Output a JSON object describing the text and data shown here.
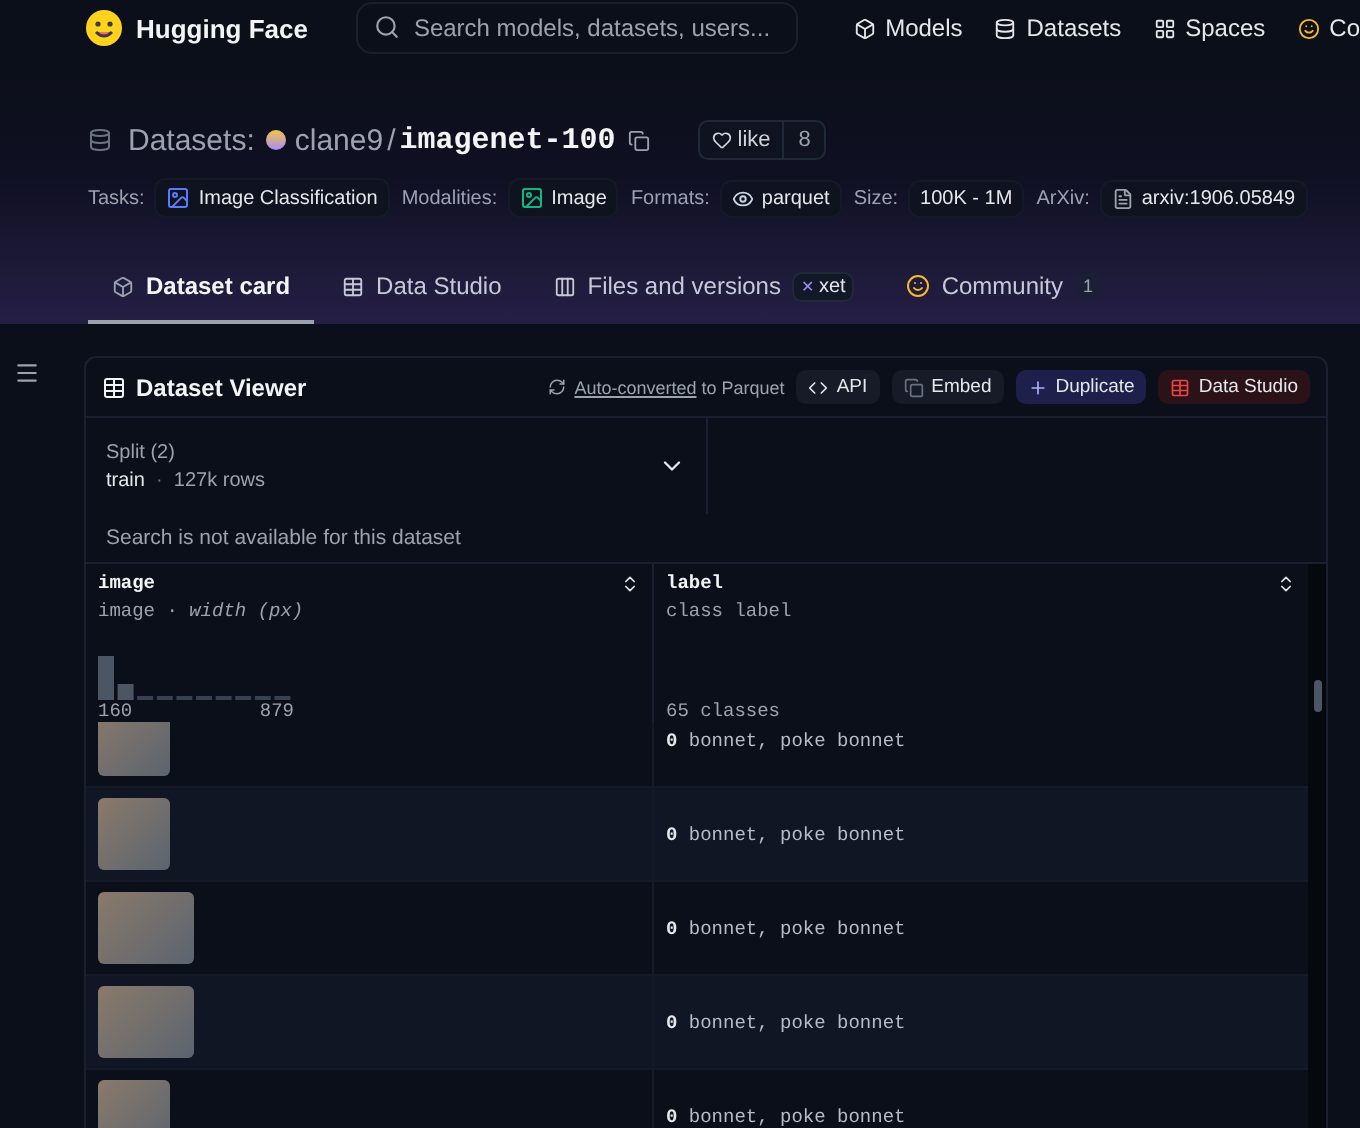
{
  "header": {
    "brand": "Hugging Face",
    "search": {
      "placeholder": "Search models, datasets, users..."
    },
    "nav": [
      {
        "label": "Models",
        "kind": "models"
      },
      {
        "label": "Datasets",
        "kind": "datasets"
      },
      {
        "label": "Spaces",
        "kind": "spaces"
      },
      {
        "label": "Co",
        "kind": "community"
      }
    ]
  },
  "repo": {
    "prefix": "Datasets:",
    "owner": "clane9",
    "separator": "/",
    "name": "imagenet-100",
    "like": {
      "label": "like",
      "count": "8"
    }
  },
  "tags": [
    {
      "key": "Tasks:",
      "value": "Image Classification",
      "kind": "task"
    },
    {
      "key": "Modalities:",
      "value": "Image",
      "kind": "modality"
    },
    {
      "key": "Formats:",
      "value": "parquet",
      "kind": "format"
    },
    {
      "key": "Size:",
      "value": "100K - 1M",
      "kind": "size"
    },
    {
      "key": "ArXiv:",
      "value": "arxiv:1906.05849",
      "kind": "arxiv"
    }
  ],
  "tabs": [
    {
      "label": "Dataset card",
      "selected": true,
      "kind": "card"
    },
    {
      "label": "Data Studio",
      "selected": false,
      "kind": "studio"
    },
    {
      "label": "Files and versions",
      "selected": false,
      "kind": "files",
      "badge": {
        "mark": "✕",
        "text": "xet"
      }
    },
    {
      "label": "Community",
      "selected": false,
      "kind": "community",
      "count": "1"
    }
  ],
  "viewer": {
    "title": "Dataset Viewer",
    "converted": {
      "link": "Auto-converted",
      "rest": "to Parquet"
    },
    "actions": [
      {
        "label": "API",
        "kind": "api"
      },
      {
        "label": "Embed",
        "kind": "embed"
      },
      {
        "label": "Duplicate",
        "kind": "duplicate"
      },
      {
        "label": "Data Studio",
        "kind": "studio"
      }
    ],
    "split": {
      "label": "Split (2)",
      "name": "train",
      "separator": "·",
      "rows": "127k rows"
    },
    "search_note": "Search is not available for this dataset",
    "columns": [
      {
        "name": "image",
        "subtitle": "image · *width (px)*",
        "min": "160",
        "max": "879"
      },
      {
        "name": "label",
        "subtitle": "class label",
        "summary": "65 classes"
      }
    ],
    "rows": [
      {
        "kind": "square",
        "label": "**0** bonnet, poke bonnet"
      },
      {
        "kind": "square",
        "label": "**0** bonnet, poke bonnet"
      },
      {
        "kind": "wide",
        "label": "**0** bonnet, poke bonnet"
      },
      {
        "kind": "wide",
        "label": "**0** bonnet, poke bonnet"
      },
      {
        "kind": "square",
        "label": "**0** bonnet, poke bonnet"
      }
    ]
  }
}
